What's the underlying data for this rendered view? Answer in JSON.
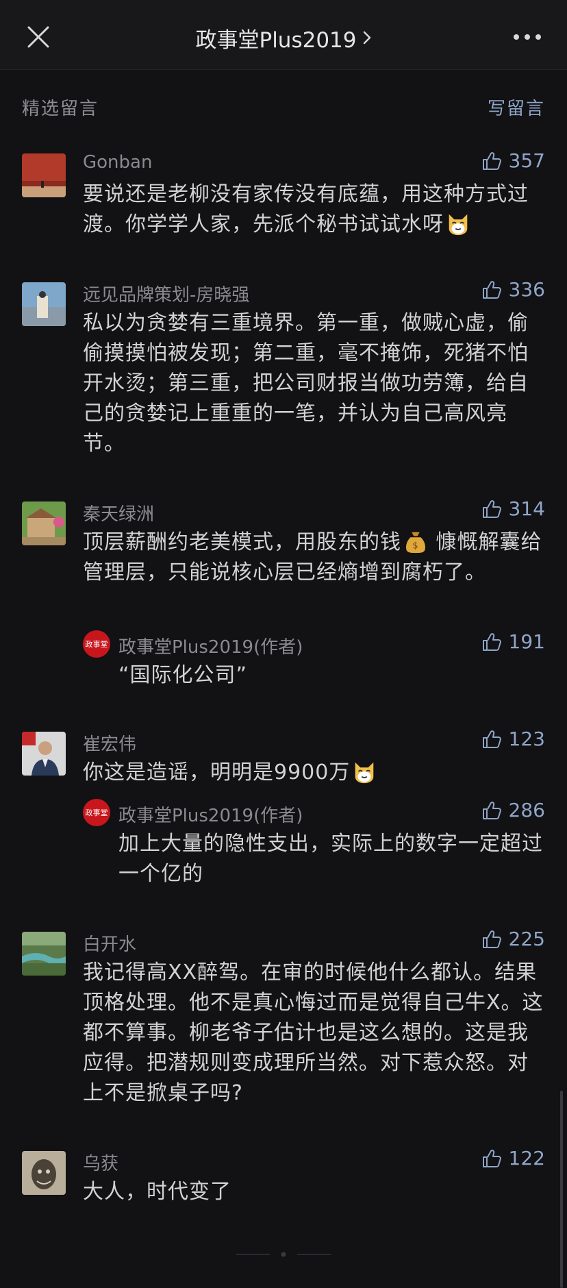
{
  "header": {
    "title": "政事堂Plus2019",
    "chevron": "chevron-right-icon",
    "close_icon": "close-icon",
    "more_icon": "more-icon"
  },
  "section": {
    "title": "精选留言",
    "write_label": "写留言"
  },
  "colors": {
    "background": "#121114",
    "accent": "#8fa6c8",
    "text": "#d2d2d4",
    "muted": "#8a8a8f"
  },
  "comments": [
    {
      "name": "Gonban",
      "likes": "357",
      "text": "要说还是老柳没有家传没有底蕴，用这种方式过渡。你学学人家，先派个秘书试试水呀",
      "emoji": "cat-emoji"
    },
    {
      "name": "远见品牌策划-房晓强",
      "likes": "336",
      "text": "私以为贪婪有三重境界。第一重，做贼心虚，偷偷摸摸怕被发现；第二重，毫不掩饰，死猪不怕开水烫；第三重，把公司财报当做功劳簿，给自己的贪婪记上重重的一笔，并认为自己高风亮节。"
    },
    {
      "name": "秦天绿洲",
      "likes": "314",
      "text_before": "顶层薪酬约老美模式，用股东的钱",
      "emoji": "money-bag-emoji",
      "text_after": " 慷慨解囊给管理层，只能说核心层已经熵增到腐朽了。",
      "reply": {
        "name": "政事堂Plus2019(作者)",
        "likes": "191",
        "text": "“国际化公司”",
        "avatar_text": "政事堂"
      }
    },
    {
      "name": "崔宏伟",
      "likes": "123",
      "text": "你这是造谣，明明是9900万",
      "emoji": "cat-emoji",
      "reply": {
        "name": "政事堂Plus2019(作者)",
        "likes": "286",
        "text": "加上大量的隐性支出，实际上的数字一定超过一个亿的",
        "avatar_text": "政事堂"
      }
    },
    {
      "name": "白开水",
      "likes": "225",
      "text": "我记得高XX醉驾。在审的时候他什么都认。结果顶格处理。他不是真心悔过而是觉得自己牛X。这都不算事。柳老爷子估计也是这么想的。这是我应得。把潜规则变成理所当然。对下惹众怒。对上不是掀桌子吗?"
    },
    {
      "name": "乌获",
      "likes": "122",
      "text": "大人，时代变了"
    }
  ]
}
